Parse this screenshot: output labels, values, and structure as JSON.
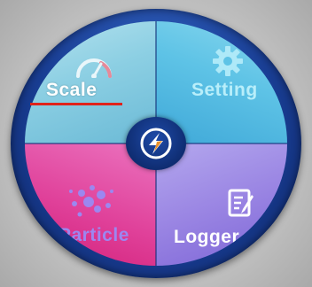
{
  "menu": {
    "items": [
      {
        "label": "Scale",
        "icon": "gauge-icon"
      },
      {
        "label": "Setting",
        "icon": "gear-icon"
      },
      {
        "label": "Particle",
        "icon": "particle-dots-icon"
      },
      {
        "label": "Logger",
        "icon": "notepad-icon"
      }
    ],
    "center_icon": "lightning-logo-icon",
    "selected": "Scale"
  },
  "colors": {
    "scale": "#8ccfe3",
    "setting": "#5ec3e6",
    "particle": "#e0419a",
    "logger": "#9a85e3",
    "ring": "#1a3f95",
    "selection_underline": "#e0231b"
  }
}
